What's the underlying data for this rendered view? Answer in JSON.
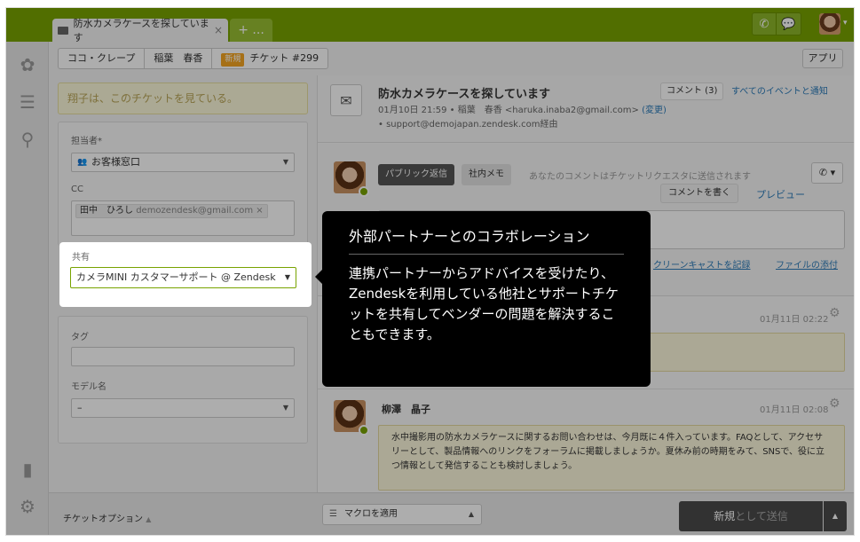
{
  "topbar": {
    "tab_title": "防水カメラケースを探しています",
    "tab_close": "×",
    "add_tab": "+ ...",
    "colors": {
      "accent": "#78a300"
    }
  },
  "breadcrumb": {
    "org": "ココ・クレープ",
    "requester": "稲葉　春香",
    "status_badge": "新規",
    "ticket": "チケット #299"
  },
  "apps_button": "アプリ",
  "left_panel": {
    "viewing_notice": "翔子は、このチケットを見ている。",
    "assignee_label": "担当者*",
    "assignee_value": "お客様窓口",
    "cc_label": "CC",
    "cc_token_name": "田中　ひろし",
    "cc_token_email": "demozendesk@gmail.com",
    "cc_token_remove": "×",
    "share_label": "共有",
    "share_value": "カメラMINI カスタマーサポート @ Zendesk",
    "tags_label": "タグ",
    "model_label": "モデル名",
    "model_value": "–"
  },
  "ticket": {
    "title": "防水カメラケースを探しています",
    "date": "01月10日 21:59",
    "requester": "稲葉　春香",
    "email": "<haruka.inaba2@gmail.com>",
    "change_link": "(変更)",
    "via": "support@demojapan.zendesk.com経由",
    "comment_count": "コメント (3)",
    "all_events": "すべてのイベントと通知"
  },
  "composer": {
    "public_reply": "パブリック返信",
    "internal_note": "社内メモ",
    "send_note": "あなたのコメントはチケットリクエスタに送信されます",
    "write_comment": "コメントを書く",
    "preview": "プレビュー",
    "screencast": "クリーンキャストを記録",
    "attach": "ファイルの添付"
  },
  "events": [
    {
      "time": "01月11日 02:22"
    },
    {
      "author": "柳澤　晶子",
      "time": "01月11日 02:08",
      "body": "水中撮影用の防水カメラケースに関するお問い合わせは、今月既に４件入っています。FAQとして、アクセサリーとして、製品情報へのリンクをフォーラムに掲載しましょうか。夏休み前の時期をみて、SNSで、役に立つ情報として発信することも検討しましょう。"
    }
  ],
  "bottombar": {
    "ticket_options": "チケットオプション",
    "macro": "マクロを適用",
    "submit_prefix": "新規",
    "submit_suffix": "として送信"
  },
  "tooltip": {
    "title": "外部パートナーとのコラボレーション",
    "body": "連携パートナーからアドバイスを受けたり、Zendeskを利用している他社とサポートチケットを共有してベンダーの問題を解決することもできます。"
  }
}
